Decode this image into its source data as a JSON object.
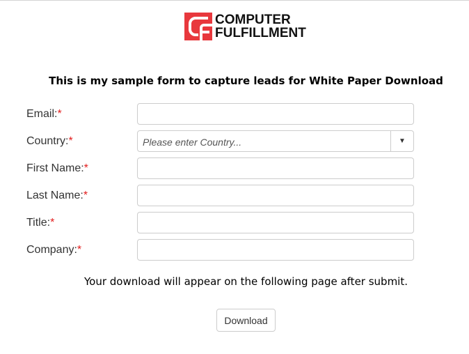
{
  "logo": {
    "line1": "COMPUTER",
    "line2": "FULFILLMENT",
    "brand_color": "#e8383d"
  },
  "heading": "This is my sample form to capture leads for White Paper Download",
  "fields": [
    {
      "label": "Email:",
      "required": "*",
      "value": "",
      "placeholder": ""
    },
    {
      "label": "Country:",
      "required": "*",
      "value": "",
      "placeholder": "Please enter Country..."
    },
    {
      "label": "First Name:",
      "required": "*",
      "value": "",
      "placeholder": ""
    },
    {
      "label": "Last Name:",
      "required": "*",
      "value": "",
      "placeholder": ""
    },
    {
      "label": "Title:",
      "required": "*",
      "value": "",
      "placeholder": ""
    },
    {
      "label": "Company:",
      "required": "*",
      "value": "",
      "placeholder": ""
    }
  ],
  "dropdown_icon": "▼",
  "note": "Your download will appear on the following page after submit.",
  "submit_label": "Download"
}
